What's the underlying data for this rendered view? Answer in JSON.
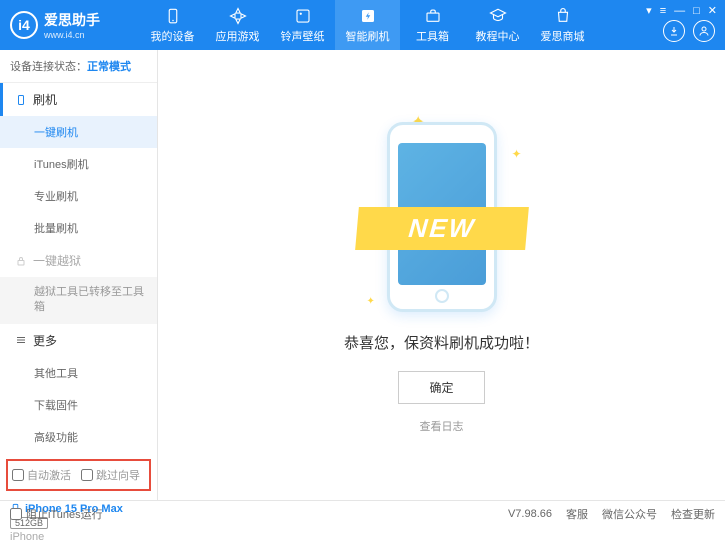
{
  "app": {
    "title": "爱思助手",
    "subtitle": "www.i4.cn"
  },
  "nav": [
    {
      "label": "我的设备"
    },
    {
      "label": "应用游戏"
    },
    {
      "label": "铃声壁纸"
    },
    {
      "label": "智能刷机"
    },
    {
      "label": "工具箱"
    },
    {
      "label": "教程中心"
    },
    {
      "label": "爱思商城"
    }
  ],
  "status": {
    "label": "设备连接状态：",
    "value": "正常模式"
  },
  "sidebar": {
    "flash_header": "刷机",
    "items_flash": [
      "一键刷机",
      "iTunes刷机",
      "专业刷机",
      "批量刷机"
    ],
    "jailbreak_header": "一键越狱",
    "jailbreak_moved": "越狱工具已转移至工具箱",
    "more_header": "更多",
    "items_more": [
      "其他工具",
      "下载固件",
      "高级功能"
    ]
  },
  "checkboxes": {
    "auto_activate": "自动激活",
    "skip_guide": "跳过向导"
  },
  "device": {
    "name": "iPhone 15 Pro Max",
    "storage": "512GB",
    "type": "iPhone"
  },
  "content": {
    "banner": "NEW",
    "message": "恭喜您，保资料刷机成功啦！",
    "confirm": "确定",
    "log": "查看日志"
  },
  "footer": {
    "block_itunes": "阻止iTunes运行",
    "version": "V7.98.66",
    "links": [
      "客服",
      "微信公众号",
      "检查更新"
    ]
  }
}
